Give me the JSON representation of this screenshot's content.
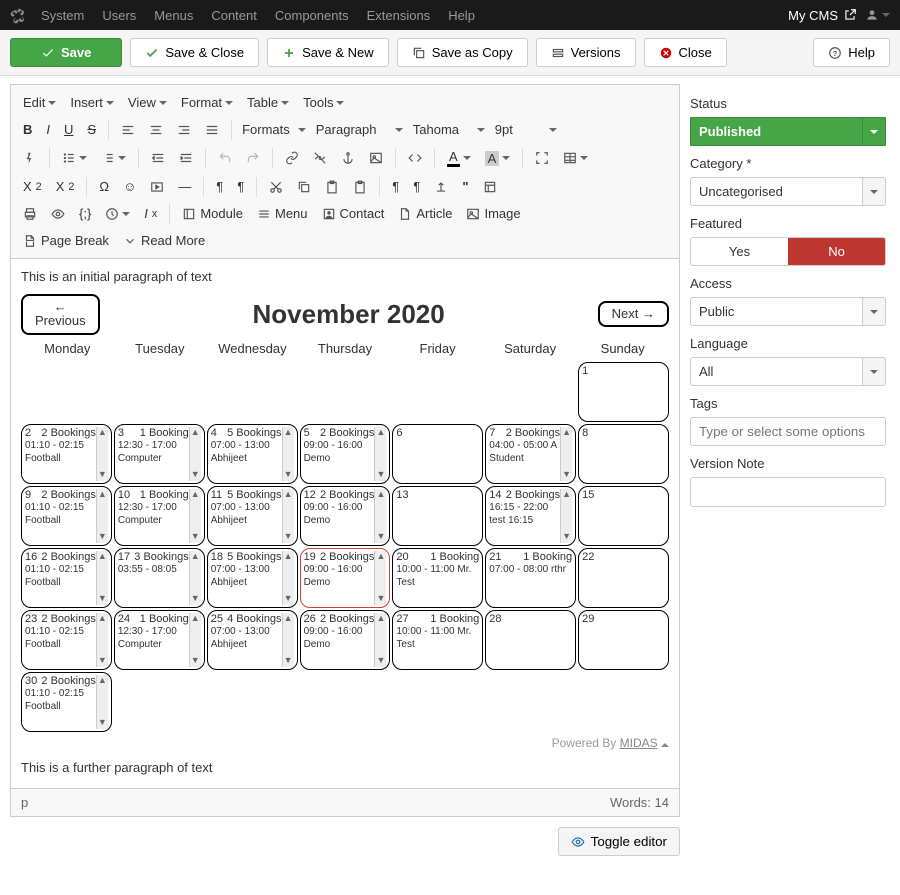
{
  "topbar": {
    "menu": [
      "System",
      "Users",
      "Menus",
      "Content",
      "Components",
      "Extensions",
      "Help"
    ],
    "cms_label": "My CMS"
  },
  "toolbar": {
    "save": "Save",
    "save_close": "Save & Close",
    "save_new": "Save & New",
    "save_copy": "Save as Copy",
    "versions": "Versions",
    "close": "Close",
    "help": "Help"
  },
  "editor_menus": {
    "edit": "Edit",
    "insert": "Insert",
    "view": "View",
    "format": "Format",
    "table": "Table",
    "tools": "Tools"
  },
  "editor_selects": {
    "formats": "Formats",
    "block": "Paragraph",
    "font": "Tahoma",
    "size": "9pt"
  },
  "editor_buttons": {
    "module": "Module",
    "menu": "Menu",
    "contact": "Contact",
    "article": "Article",
    "image": "Image",
    "page_break": "Page Break",
    "read_more": "Read More"
  },
  "content": {
    "p1": "This is an initial paragraph of text",
    "p2": "This is a further paragraph of text",
    "calendar": {
      "prev_arrow": "←",
      "prev": "Previous",
      "next": "Next →",
      "title": "November 2020",
      "days": [
        "Monday",
        "Tuesday",
        "Wednesday",
        "Thursday",
        "Friday",
        "Saturday",
        "Sunday"
      ],
      "powered": "Powered By",
      "powered_link": "MIDAS",
      "cells": [
        {
          "day": "",
          "text": "",
          "scroll": false
        },
        {
          "day": "",
          "text": "",
          "scroll": false
        },
        {
          "day": "",
          "text": "",
          "scroll": false
        },
        {
          "day": "",
          "text": "",
          "scroll": false
        },
        {
          "day": "",
          "text": "",
          "scroll": false
        },
        {
          "day": "",
          "text": "",
          "scroll": false
        },
        {
          "day": "1",
          "text": "",
          "scroll": false
        },
        {
          "day": "2",
          "count": "2 Bookings",
          "text": "01:10 - 02:15 Football",
          "scroll": true
        },
        {
          "day": "3",
          "count": "1 Booking",
          "text": "12:30 - 17:00 Computer",
          "scroll": true
        },
        {
          "day": "4",
          "count": "5 Bookings",
          "text": "07:00 - 13:00 Abhijeet",
          "scroll": true
        },
        {
          "day": "5",
          "count": "2 Bookings",
          "text": "09:00 - 16:00 Demo",
          "scroll": true
        },
        {
          "day": "6",
          "text": "",
          "scroll": false
        },
        {
          "day": "7",
          "count": "2 Bookings",
          "text": "04:00 - 05:00 A Student",
          "scroll": true
        },
        {
          "day": "8",
          "text": "",
          "scroll": false
        },
        {
          "day": "9",
          "count": "2 Bookings",
          "text": "01:10 - 02:15 Football",
          "scroll": true
        },
        {
          "day": "10",
          "count": "1 Booking",
          "text": "12:30 - 17:00 Computer",
          "scroll": true
        },
        {
          "day": "11",
          "count": "5 Bookings",
          "text": "07:00 - 13:00 Abhijeet",
          "scroll": true
        },
        {
          "day": "12",
          "count": "2 Bookings",
          "text": "09:00 - 16:00 Demo",
          "scroll": true
        },
        {
          "day": "13",
          "text": "",
          "scroll": false
        },
        {
          "day": "14",
          "count": "2 Bookings",
          "text": "16:15 - 22:00 test 16:15",
          "scroll": true
        },
        {
          "day": "15",
          "text": "",
          "scroll": false
        },
        {
          "day": "16",
          "count": "2 Bookings",
          "text": "01:10 - 02:15 Football",
          "scroll": true
        },
        {
          "day": "17",
          "count": "3 Bookings",
          "text": "03:55 - 08:05",
          "scroll": true
        },
        {
          "day": "18",
          "count": "5 Bookings",
          "text": "07:00 - 13:00 Abhijeet",
          "scroll": true
        },
        {
          "day": "19",
          "count": "2 Bookings",
          "text": "09:00 - 16:00 Demo",
          "scroll": true,
          "today": true
        },
        {
          "day": "20",
          "count": "1 Booking",
          "text": "10:00 - 11:00 Mr. Test",
          "scroll": false
        },
        {
          "day": "21",
          "count": "1 Booking",
          "text": "07:00 - 08:00 rthr",
          "scroll": false
        },
        {
          "day": "22",
          "text": "",
          "scroll": false
        },
        {
          "day": "23",
          "count": "2 Bookings",
          "text": "01:10 - 02:15 Football",
          "scroll": true
        },
        {
          "day": "24",
          "count": "1 Booking",
          "text": "12:30 - 17:00 Computer",
          "scroll": true
        },
        {
          "day": "25",
          "count": "4 Bookings",
          "text": "07:00 - 13:00 Abhijeet",
          "scroll": true
        },
        {
          "day": "26",
          "count": "2 Bookings",
          "text": "09:00 - 16:00 Demo",
          "scroll": true
        },
        {
          "day": "27",
          "count": "1 Booking",
          "text": "10:00 - 11:00 Mr. Test",
          "scroll": false
        },
        {
          "day": "28",
          "text": "",
          "scroll": false
        },
        {
          "day": "29",
          "text": "",
          "scroll": false
        },
        {
          "day": "30",
          "count": "2 Bookings",
          "text": "01:10 - 02:15 Football",
          "scroll": true
        }
      ]
    }
  },
  "status_bar": {
    "path": "p",
    "words_label": "Words:",
    "words": "14"
  },
  "toggle_editor": "Toggle editor",
  "sidebar": {
    "status_label": "Status",
    "status_value": "Published",
    "category_label": "Category *",
    "category_value": "Uncategorised",
    "featured_label": "Featured",
    "featured_yes": "Yes",
    "featured_no": "No",
    "access_label": "Access",
    "access_value": "Public",
    "language_label": "Language",
    "language_value": "All",
    "tags_label": "Tags",
    "tags_placeholder": "Type or select some options",
    "version_label": "Version Note"
  }
}
